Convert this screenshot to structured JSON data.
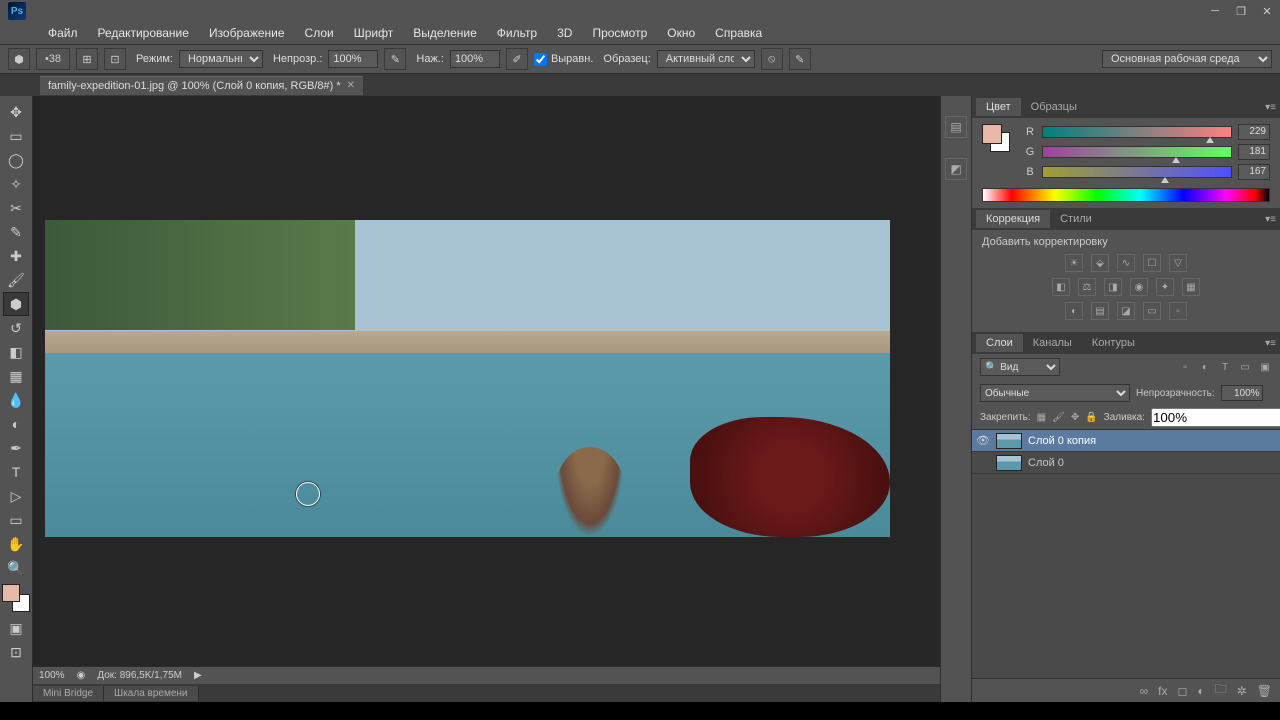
{
  "menus": [
    "Файл",
    "Редактирование",
    "Изображение",
    "Слои",
    "Шрифт",
    "Выделение",
    "Фильтр",
    "3D",
    "Просмотр",
    "Окно",
    "Справка"
  ],
  "options": {
    "brush_size": "38",
    "mode_label": "Режим:",
    "mode_value": "Нормальный",
    "opacity_label": "Непрозр.:",
    "opacity_value": "100%",
    "flow_label": "Наж.:",
    "flow_value": "100%",
    "align_label": "Выравн.",
    "sample_label": "Образец:",
    "sample_value": "Активный слой"
  },
  "workspace": "Основная рабочая среда",
  "doc_tab": "family-expedition-01.jpg @ 100% (Слой 0 копия, RGB/8#) *",
  "status": {
    "zoom": "100%",
    "doc": "Док: 896,5K/1,75M"
  },
  "bottom_tabs": [
    "Mini Bridge",
    "Шкала времени"
  ],
  "panels": {
    "color_tab": "Цвет",
    "swatches_tab": "Образцы",
    "r_label": "R",
    "g_label": "G",
    "b_label": "B",
    "r_val": "229",
    "g_val": "181",
    "b_val": "167",
    "correction_tab": "Коррекция",
    "styles_tab": "Стили",
    "add_adjust": "Добавить корректировку",
    "layers_tab": "Слои",
    "channels_tab": "Каналы",
    "paths_tab": "Контуры",
    "search_kind": "Вид",
    "blend_mode": "Обычные",
    "opacity_label": "Непрозрачность:",
    "opacity_val": "100%",
    "lock_label": "Закрепить:",
    "fill_label": "Заливка:",
    "fill_val": "100%",
    "layers": [
      {
        "name": "Слой 0 копия",
        "visible": true,
        "selected": true
      },
      {
        "name": "Слой 0",
        "visible": false,
        "selected": false
      }
    ]
  }
}
